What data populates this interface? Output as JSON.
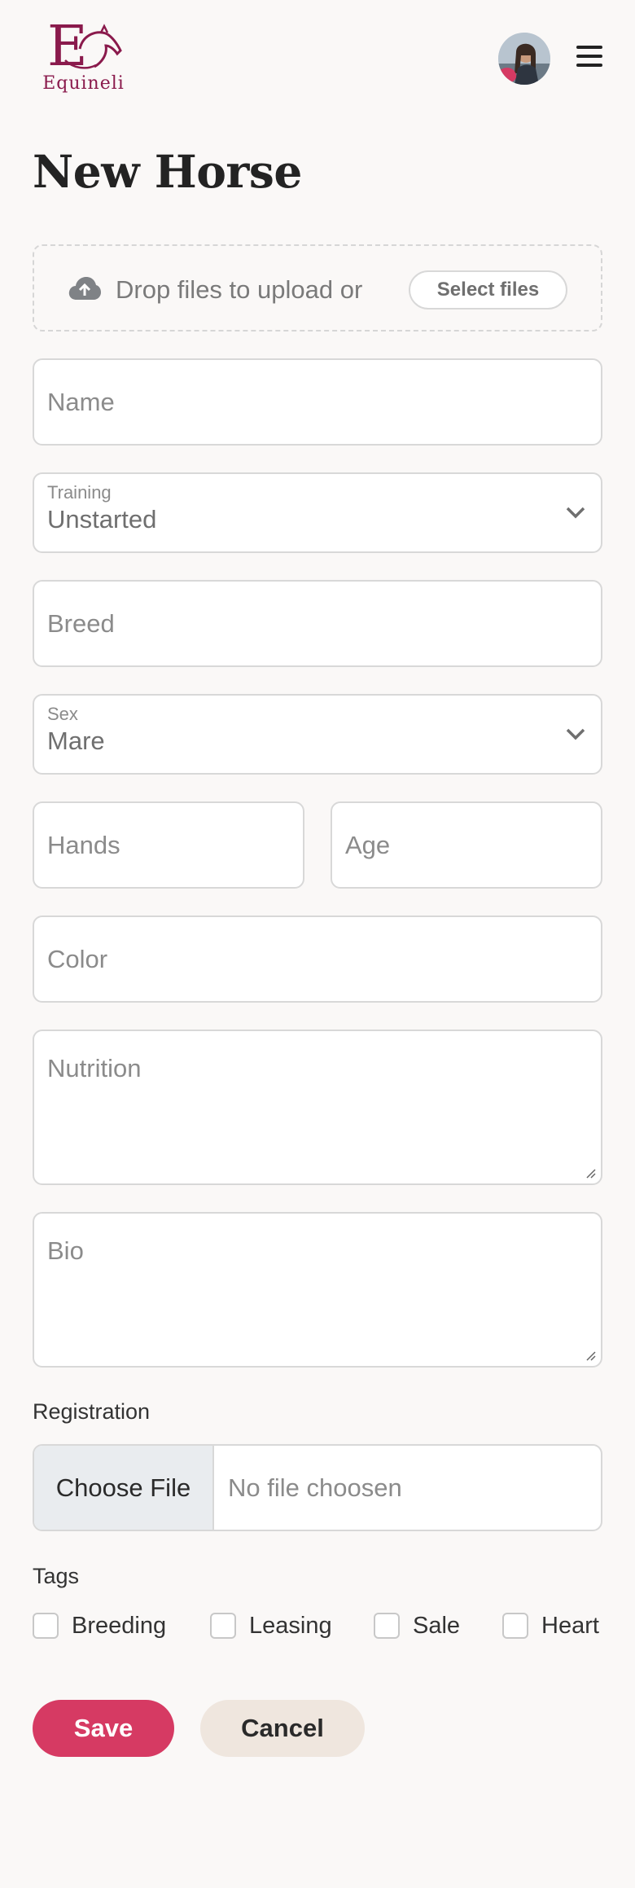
{
  "brand": {
    "name": "Equineli",
    "color": "#8a1a4c"
  },
  "header": {
    "avatar_icon": "user-avatar",
    "menu_icon": "hamburger-menu-icon"
  },
  "page": {
    "title": "New Horse"
  },
  "upload": {
    "text": "Drop files to upload or",
    "button_label": "Select files",
    "icon": "cloud-upload-icon"
  },
  "form": {
    "name": {
      "placeholder": "Name"
    },
    "training": {
      "label": "Training",
      "value": "Unstarted"
    },
    "breed": {
      "placeholder": "Breed"
    },
    "sex": {
      "label": "Sex",
      "value": "Mare"
    },
    "hands": {
      "placeholder": "Hands"
    },
    "age": {
      "placeholder": "Age"
    },
    "color": {
      "placeholder": "Color"
    },
    "nutrition": {
      "placeholder": "Nutrition"
    },
    "bio": {
      "placeholder": "Bio"
    }
  },
  "registration": {
    "label": "Registration",
    "choose_label": "Choose File",
    "status": "No file choosen"
  },
  "tags": {
    "label": "Tags",
    "items": [
      "Breeding",
      "Leasing",
      "Sale",
      "Heart"
    ]
  },
  "actions": {
    "save_label": "Save",
    "cancel_label": "Cancel",
    "save_color": "#d63a63",
    "cancel_color": "#efe6de"
  }
}
